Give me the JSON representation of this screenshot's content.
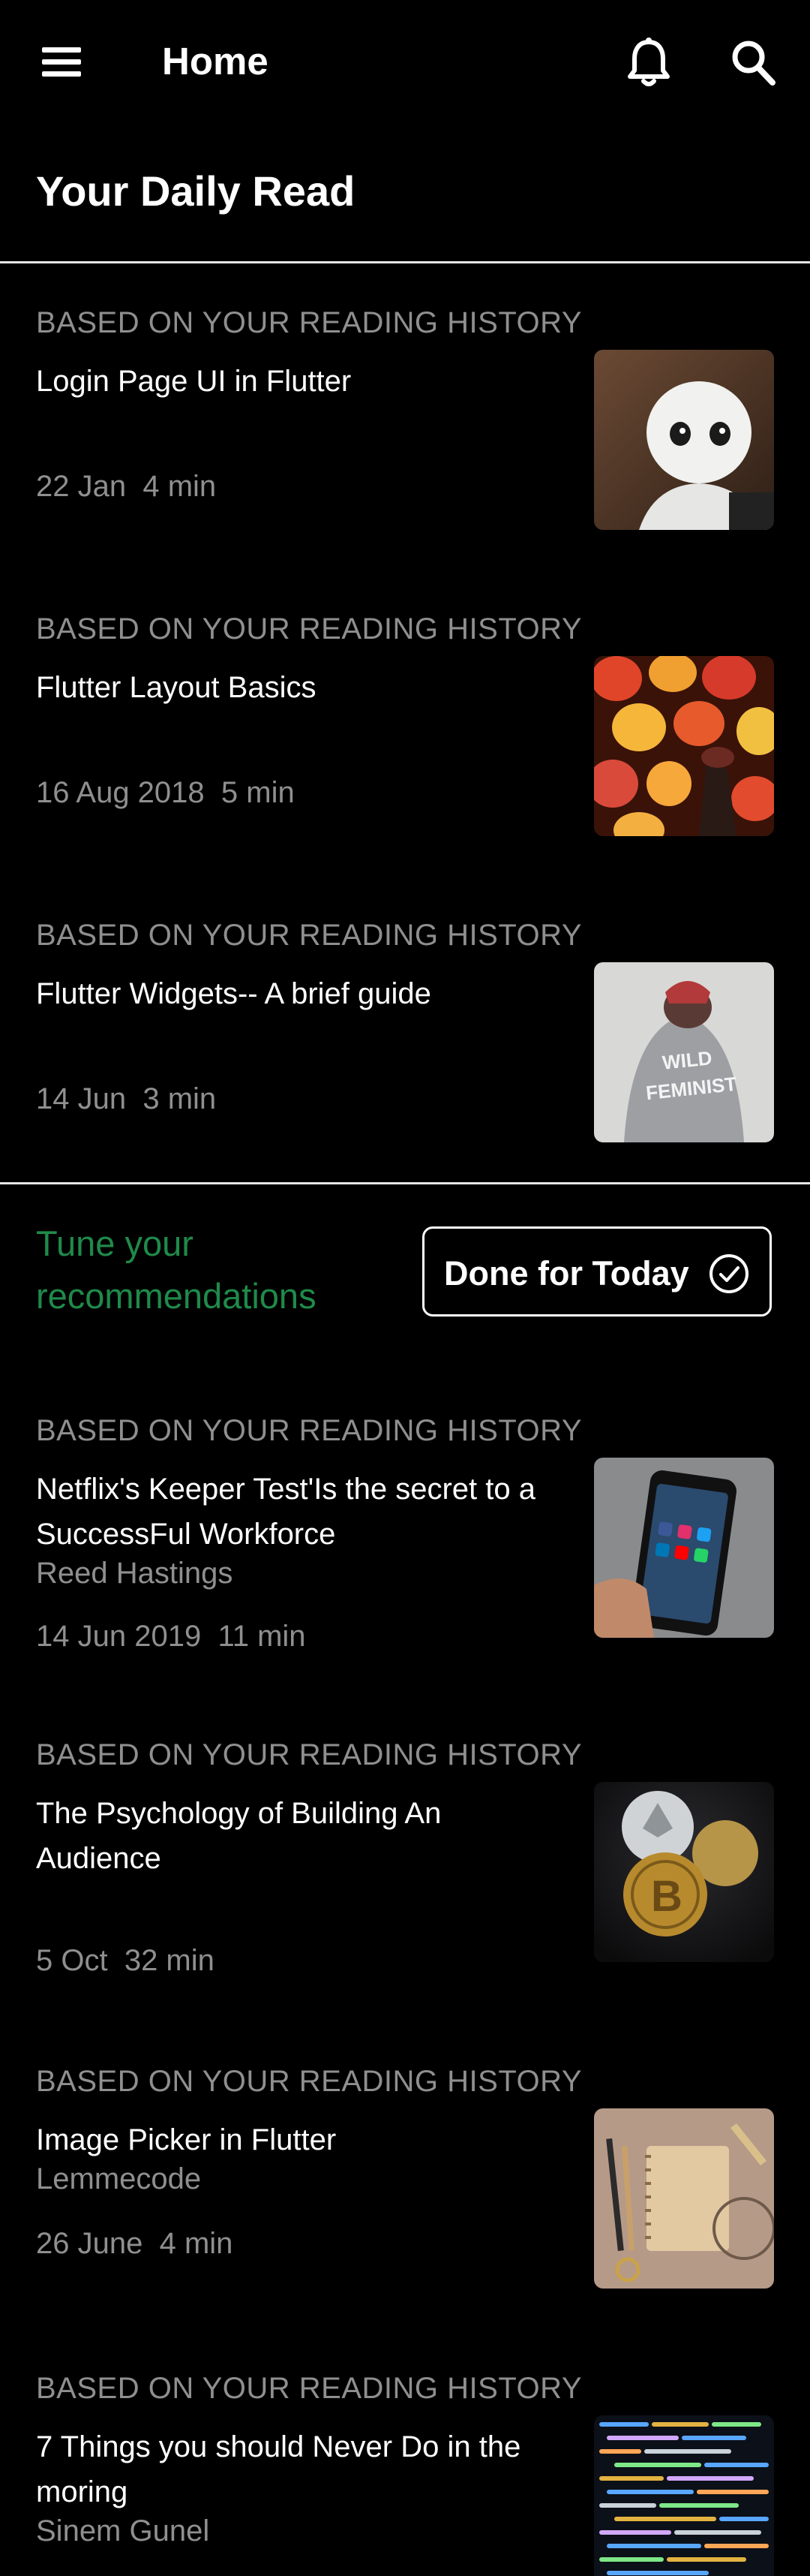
{
  "appbar": {
    "title": "Home"
  },
  "section": {
    "title": "Your Daily Read"
  },
  "articles_top": [
    {
      "tag": "BASED ON YOUR READING HISTORY",
      "title": "Login Page UI in Flutter",
      "date": "22 Jan",
      "read_time": "4 min",
      "image": "robot-image"
    },
    {
      "tag": "BASED ON YOUR READING HISTORY",
      "title": "Flutter Layout Basics",
      "date": "16 Aug 2018",
      "read_time": "5 min",
      "image": "lanterns-image"
    },
    {
      "tag": "BASED ON YOUR READING HISTORY",
      "title": "Flutter Widgets-- A brief guide",
      "date": "14 Jun",
      "read_time": "3 min",
      "image": "jacket-image"
    }
  ],
  "tune": {
    "text_line1": "Tune your",
    "text_line2": "recommendations",
    "button_label": "Done for Today"
  },
  "articles_bottom": [
    {
      "tag": "BASED ON YOUR READING HISTORY",
      "title": "Netflix's Keeper Test'Is the secret to a SuccessFul Workforce",
      "author": "Reed Hastings",
      "date": "14 Jun 2019",
      "read_time": "11 min",
      "image": "phone-image"
    },
    {
      "tag": "BASED ON YOUR READING HISTORY",
      "title": "The Psychology of Building An Audience",
      "date": "5 Oct",
      "read_time": "32 min",
      "image": "coins-image"
    },
    {
      "tag": "BASED ON YOUR READING HISTORY",
      "title": "Image Picker in Flutter",
      "author": "Lemmecode",
      "date": "26 June",
      "read_time": "4 min",
      "image": "notebook-image"
    },
    {
      "tag": "BASED ON YOUR READING HISTORY",
      "title": "7 Things you should Never Do in the moring",
      "author": "Sinem Gunel",
      "image": "code-image"
    }
  ],
  "colors": {
    "accent_green": "#1f8a4a",
    "muted_text": "#8f8f8f",
    "background": "#000000"
  }
}
